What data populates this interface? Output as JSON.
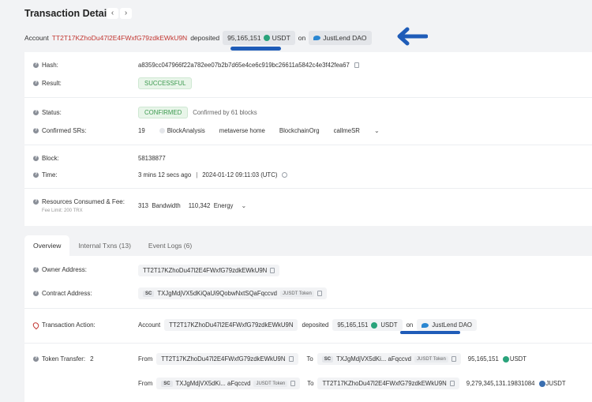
{
  "header": {
    "title": "Transaction Details",
    "prev_icon": "‹",
    "next_icon": "›"
  },
  "summary": {
    "account_word": "Account",
    "address": "TT2T17KZhoDu47l2E4FWxfG79zdkEWkU9N",
    "action": "deposited",
    "amount": "95,165,151",
    "token": "USDT",
    "on_word": "on",
    "protocol": "JustLend DAO"
  },
  "info": {
    "hash_label": "Hash:",
    "hash_value": "a8359cc047966f22a782ee07b2b7d65e4ce6c919bc26611a5842c4e3f42fea67",
    "result_label": "Result:",
    "result_value": "SUCCESSFUL",
    "status_label": "Status:",
    "status_value": "CONFIRMED",
    "status_note": "Confirmed by 61 blocks",
    "srs_label": "Confirmed SRs:",
    "srs_count": "19",
    "srs": [
      "BlockAnalysis",
      "metaverse home",
      "BlockchainOrg",
      "callmeSR"
    ],
    "block_label": "Block:",
    "block_value": "58138877",
    "time_label": "Time:",
    "time_ago": "3 mins 12 secs ago",
    "time_sep": "|",
    "time_value": "2024-01-12 09:11:03 (UTC)",
    "resources_label": "Resources Consumed & Fee:",
    "fee_limit": "Fee Limit: 200 TRX",
    "bandwidth_value": "313",
    "bandwidth_label": "Bandwidth",
    "energy_value": "110,342",
    "energy_label": "Energy"
  },
  "tabs": [
    "Overview",
    "Internal Txns (13)",
    "Event Logs (6)"
  ],
  "overview": {
    "owner_label": "Owner Address:",
    "owner_value": "TT2T17KZhoDu47l2E4FWxfG79zdkEWkU9N",
    "contract_label": "Contract Address:",
    "contract_sc": "SC",
    "contract_value": "TXJgMdjVX5dKiQaUi9QobwNxtSQaFqccvd",
    "contract_token": "JUSDT Token",
    "action_label": "Transaction Action:",
    "action_account": "Account",
    "action_address": "TT2T17KZhoDu47l2E4FWxfG79zdkEWkU9N",
    "action_verb": "deposited",
    "action_amount": "95,165,151",
    "action_token": "USDT",
    "action_on": "on",
    "action_protocol": "JustLend DAO",
    "transfer_label": "Token Transfer:",
    "transfer_count": "2",
    "transfers": [
      {
        "from_word": "From",
        "from": "TT2T17KZhoDu47l2E4FWxfG79zdkEWkU9N",
        "to_word": "To",
        "to_sc": "SC",
        "to": "TXJgMdjVX5dKi... aFqccvd",
        "to_token": "JUSDT Token",
        "amount": "95,165,151",
        "token": "USDT"
      },
      {
        "from_word": "From",
        "from_sc": "SC",
        "from": "TXJgMdjVX5dKi... aFqccvd",
        "from_token": "JUSDT Token",
        "to_word": "To",
        "to": "TT2T17KZhoDu47l2E4FWxfG79zdkEWkU9N",
        "amount": "9,279,345,131.19831084",
        "token": "JUSDT"
      }
    ]
  },
  "colors": {
    "accent_red": "#c23631",
    "annotation_blue": "#1f5cb8",
    "success_green": "#3c9a4f"
  }
}
